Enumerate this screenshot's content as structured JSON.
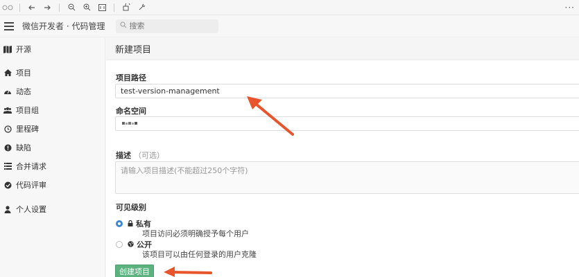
{
  "toolbar": {
    "icons": [
      "window-dots-icon",
      "back-icon",
      "forward-icon",
      "zoom-out-icon",
      "zoom-in-icon",
      "fit-icon",
      "rotate-icon",
      "markup-icon",
      "more-icon"
    ],
    "more_label": "···"
  },
  "header": {
    "title": "微信开发者 · 代码管理",
    "search_placeholder": "搜索"
  },
  "sidebar": {
    "top_item": {
      "label": "开源",
      "icon": "map-icon"
    },
    "items": [
      {
        "label": "项目",
        "icon": "home-icon"
      },
      {
        "label": "动态",
        "icon": "dashboard-icon"
      },
      {
        "label": "项目组",
        "icon": "group-icon"
      },
      {
        "label": "里程碑",
        "icon": "clock-icon"
      },
      {
        "label": "缺陷",
        "icon": "alert-icon"
      },
      {
        "label": "合并请求",
        "icon": "merge-icon"
      },
      {
        "label": "代码评审",
        "icon": "check-icon"
      }
    ],
    "settings_item": {
      "label": "个人设置",
      "icon": "user-icon"
    }
  },
  "form": {
    "page_title": "新建项目",
    "path_label": "项目路径",
    "path_value": "test-version-management",
    "namespace_label": "命名空间",
    "namespace_value": "",
    "desc_label": "描述",
    "desc_optional": "（可选）",
    "desc_placeholder": "请输入项目描述(不能超过250个字符)",
    "visibility_label": "可见级别",
    "private_title": "私有",
    "private_desc": "项目访问必须明确授予每个用户",
    "public_title": "公开",
    "public_desc": "该项目可以由任何登录的用户克隆",
    "create_button": "创建项目"
  },
  "colors": {
    "accent_blue": "#3d87d8",
    "create_green": "#5cb27f",
    "annotation_arrow": "#e8542b"
  }
}
